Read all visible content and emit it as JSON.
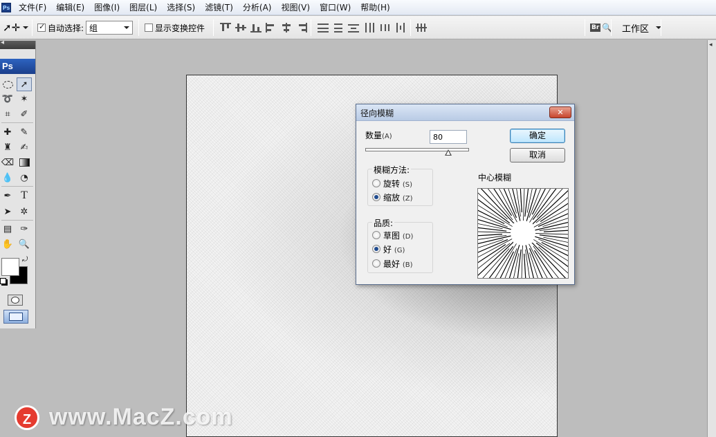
{
  "menu": [
    "文件(F)",
    "编辑(E)",
    "图像(I)",
    "图层(L)",
    "选择(S)",
    "滤镜(T)",
    "分析(A)",
    "视图(V)",
    "窗口(W)",
    "帮助(H)"
  ],
  "app_icon": "Ps",
  "options": {
    "auto_select_label": "自动选择:",
    "auto_select_checked": true,
    "auto_select_value": "组",
    "show_transform_label": "显示变换控件",
    "show_transform_checked": false,
    "workspace_label": "工作区",
    "bridge_label": "Br"
  },
  "toolbox": {
    "badge": "Ps"
  },
  "dialog": {
    "title": "径向模糊",
    "close_label": "✕",
    "amount_label": "数量",
    "amount_hotkey": "(A)",
    "amount_value": "80",
    "amount_fraction": 0.8,
    "ok_label": "确定",
    "cancel_label": "取消",
    "method_label": "模糊方法:",
    "methods": [
      {
        "label": "旋转",
        "hotkey": "(S)",
        "selected": false
      },
      {
        "label": "缩放",
        "hotkey": "(Z)",
        "selected": true
      }
    ],
    "quality_label": "品质:",
    "qualities": [
      {
        "label": "草图",
        "hotkey": "(D)",
        "selected": false
      },
      {
        "label": "好",
        "hotkey": "(G)",
        "selected": true
      },
      {
        "label": "最好",
        "hotkey": "(B)",
        "selected": false
      }
    ],
    "center_label": "中心模糊"
  },
  "watermark": {
    "logo": "Z",
    "text": "www.MacZ.com"
  }
}
